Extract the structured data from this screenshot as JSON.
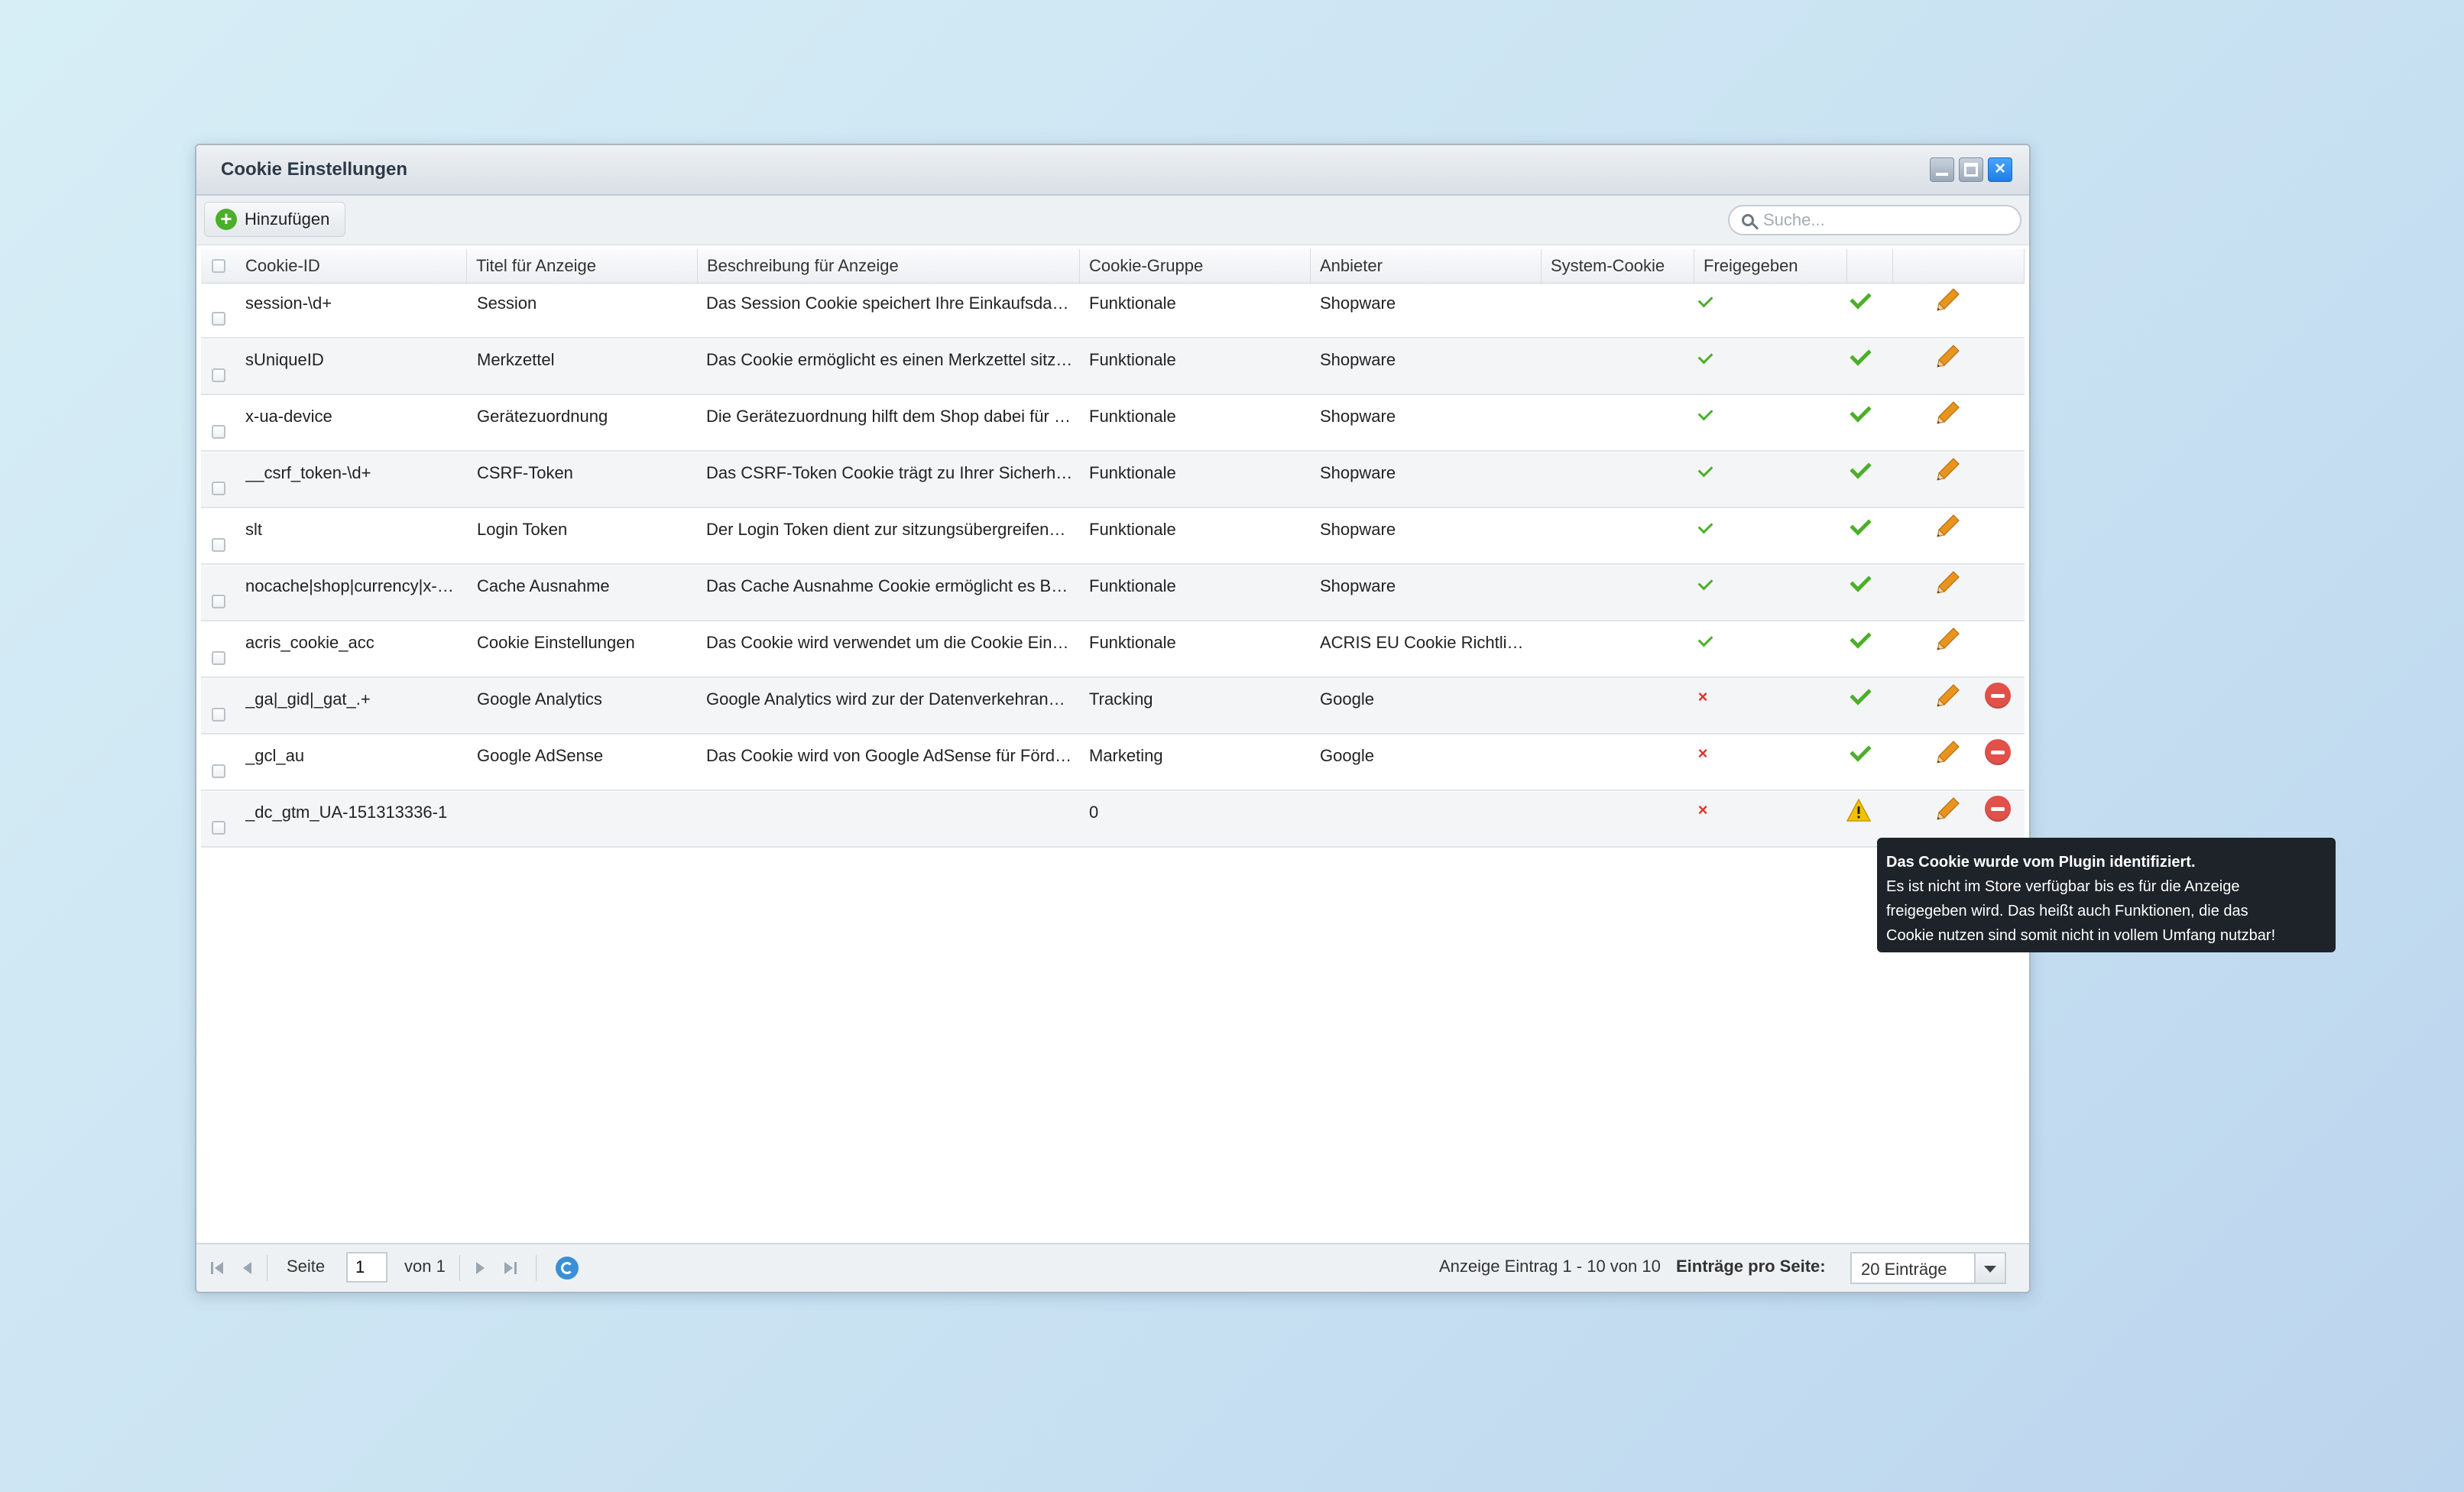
{
  "window": {
    "title": "Cookie Einstellungen",
    "close_glyph": "×"
  },
  "toolbar": {
    "add_label": "Hinzufügen",
    "search_placeholder": "Suche..."
  },
  "columns": [
    {
      "label": "Cookie-ID"
    },
    {
      "label": "Titel für Anzeige"
    },
    {
      "label": "Beschreibung für Anzeige"
    },
    {
      "label": "Cookie-Gruppe"
    },
    {
      "label": "Anbieter"
    },
    {
      "label": "System-Cookie"
    },
    {
      "label": "Freigegeben"
    },
    {
      "label": ""
    },
    {
      "label": ""
    }
  ],
  "rows": [
    {
      "id": "session-\\d+",
      "title": "Session",
      "desc": "Das Session Cookie speichert Ihre Einkaufsdaten über m…",
      "group": "Funktionale",
      "provider": "Shopware",
      "system": "yes",
      "released": "yes",
      "deletable": false
    },
    {
      "id": "sUniqueID",
      "title": "Merkzettel",
      "desc": "Das Cookie ermöglicht es einen Merkzettel sitzungsüber…",
      "group": "Funktionale",
      "provider": "Shopware",
      "system": "yes",
      "released": "yes",
      "deletable": false
    },
    {
      "id": "x-ua-device",
      "title": "Gerätezuordnung",
      "desc": "Die Gerätezuordnung hilft dem Shop dabei für die aktuell …",
      "group": "Funktionale",
      "provider": "Shopware",
      "system": "yes",
      "released": "yes",
      "deletable": false
    },
    {
      "id": "__csrf_token-\\d+",
      "title": "CSRF-Token",
      "desc": "Das CSRF-Token Cookie trägt zu Ihrer Sicherheit bei. Es …",
      "group": "Funktionale",
      "provider": "Shopware",
      "system": "yes",
      "released": "yes",
      "deletable": false
    },
    {
      "id": "slt",
      "title": "Login Token",
      "desc": "Der Login Token dient zur sitzungsübergreifenden Erken…",
      "group": "Funktionale",
      "provider": "Shopware",
      "system": "yes",
      "released": "yes",
      "deletable": false
    },
    {
      "id": "nocache|shop|currency|x-…",
      "title": "Cache Ausnahme",
      "desc": "Das Cache Ausnahme Cookie ermöglicht es Benutzern i…",
      "group": "Funktionale",
      "provider": "Shopware",
      "system": "yes",
      "released": "yes",
      "deletable": false
    },
    {
      "id": "acris_cookie_acc",
      "title": "Cookie Einstellungen",
      "desc": "Das Cookie wird verwendet um die Cookie Einstellungen …",
      "group": "Funktionale",
      "provider": "ACRIS EU Cookie Richtli…",
      "system": "yes",
      "released": "yes",
      "deletable": false
    },
    {
      "id": "_ga|_gid|_gat_.+",
      "title": "Google Analytics",
      "desc": "Google Analytics wird zur der Datenverkehranalyse der …",
      "group": "Tracking",
      "provider": "Google",
      "system": "no",
      "released": "yes",
      "deletable": true
    },
    {
      "id": "_gcl_au",
      "title": "Google AdSense",
      "desc": "Das Cookie wird von Google AdSense für Förderung der …",
      "group": "Marketing",
      "provider": "Google",
      "system": "no",
      "released": "yes",
      "deletable": true
    },
    {
      "id": "_dc_gtm_UA-151313336-1",
      "title": "",
      "desc": "",
      "group": "0",
      "provider": "",
      "system": "no",
      "released": "warning",
      "deletable": true
    }
  ],
  "pager": {
    "page_label": "Seite",
    "page_value": "1",
    "of_label": "von 1",
    "display_info": "Anzeige Eintrag 1 - 10 von 10",
    "per_page_label": "Einträge pro Seite:",
    "per_page_value": "20 Einträge"
  },
  "tooltip": {
    "title": "Das Cookie wurde vom Plugin identifiziert.",
    "lines": [
      "Es ist nicht im Store verfügbar bis es für die Anzeige",
      "freigegeben wird. Das heißt auch Funktionen, die das",
      "Cookie nutzen sind somit nicht in vollem Umfang nutzbar!"
    ]
  },
  "colors": {
    "accent_green": "#4caf2a",
    "error_red": "#e0342b",
    "edit_orange": "#e8951f",
    "delete_red": "#e2504a",
    "warning_yellow": "#f2c200"
  }
}
